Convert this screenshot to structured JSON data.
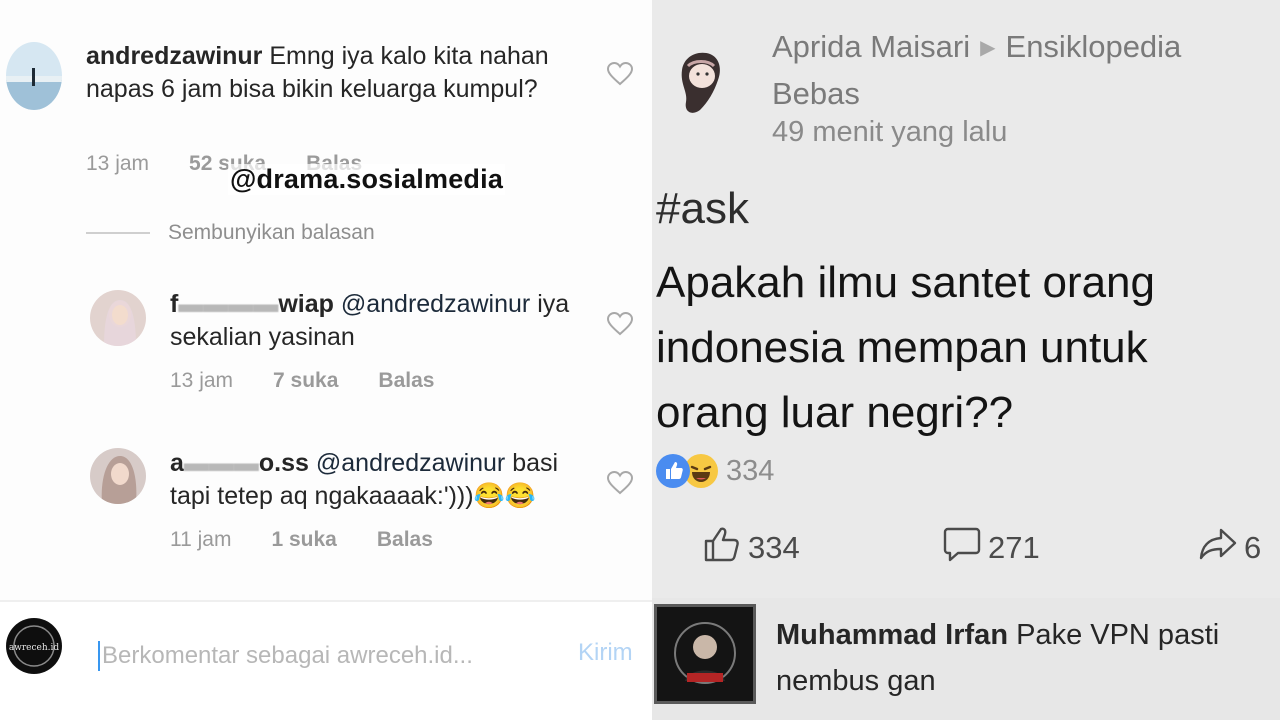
{
  "instagram": {
    "watermark": "@drama.sosialmedia",
    "comments": [
      {
        "username": "andredzawinur",
        "text": "Emng iya kalo kita nahan napas 6 jam bisa bikin keluarga kumpul?",
        "time": "13 jam",
        "likes": "52 suka",
        "reply": "Balas"
      }
    ],
    "hide_replies": "Sembunyikan balasan",
    "replies": [
      {
        "username_visible_start": "f",
        "username_visible_end": "wiap",
        "mention": "@andredzawinur",
        "text": "iya sekalian yasinan",
        "time": "13 jam",
        "likes": "7 suka",
        "reply": "Balas"
      },
      {
        "username_visible_start": "a",
        "username_visible_end": "o.ss",
        "mention": "@andredzawinur",
        "text": "basi tapi tetep aq ngakaaaak:')))",
        "emoji": "😂😂",
        "time": "11 jam",
        "likes": "1 suka",
        "reply": "Balas"
      }
    ],
    "comment_bar": {
      "placeholder": "Berkomentar sebagai awreceh.id...",
      "send": "Kirim",
      "avatar_text": "awreceh.id"
    }
  },
  "facebook": {
    "author": "Aprida Maisari",
    "group": "Ensiklopedia Bebas",
    "time": "49 menit yang lalu",
    "hashtag": "#ask",
    "question": "Apakah ilmu santet orang indonesia mempan untuk orang luar negri??",
    "reaction_count": "334",
    "actions": {
      "like": "334",
      "comment": "271",
      "share": "6"
    },
    "top_comment": {
      "author": "Muhammad Irfan",
      "text": "Pake VPN pasti nembus gan"
    }
  },
  "icons": {
    "heart": "heart-outline-icon",
    "like": "thumbs-up-icon",
    "comment": "speech-bubble-icon",
    "share": "share-arrow-icon",
    "reaction_like": "like-reaction-icon",
    "reaction_haha": "haha-reaction-icon"
  },
  "colors": {
    "instagram_link": "#3897f0",
    "fb_like_blue": "#4a8cf0",
    "haha_yellow": "#f7c843"
  }
}
